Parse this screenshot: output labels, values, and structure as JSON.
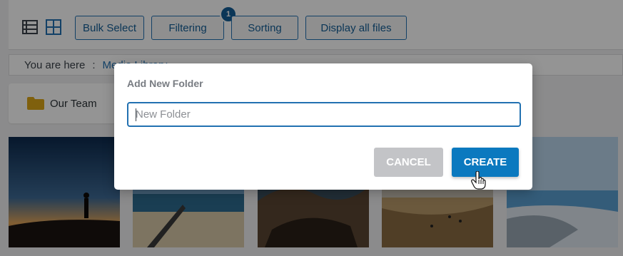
{
  "toolbar": {
    "view_icons": [
      "list-view-icon",
      "grid-view-icon"
    ],
    "buttons": {
      "bulk_select": "Bulk Select",
      "filtering": "Filtering",
      "sorting": "Sorting",
      "display_all": "Display all files"
    },
    "filter_count": "1"
  },
  "breadcrumb": {
    "prefix": "You are here",
    "separator": ":",
    "current": "Media Library"
  },
  "folders": [
    {
      "label": "Our Team",
      "icon": "folder-icon"
    }
  ],
  "thumbnails": [
    {
      "icon": "sunset-silhouette-image"
    },
    {
      "icon": "beach-image"
    },
    {
      "icon": "rocky-coast-image"
    },
    {
      "icon": "beach-people-image"
    },
    {
      "icon": "shore-image"
    }
  ],
  "dialog": {
    "title": "Add New Folder",
    "input_placeholder": "New Folder",
    "input_value": "",
    "cancel_label": "CANCEL",
    "create_label": "CREATE"
  },
  "colors": {
    "accent": "#2271b1",
    "create_button": "#0b79bf",
    "cancel_button": "#c3c4c7",
    "folder": "#dba617"
  }
}
